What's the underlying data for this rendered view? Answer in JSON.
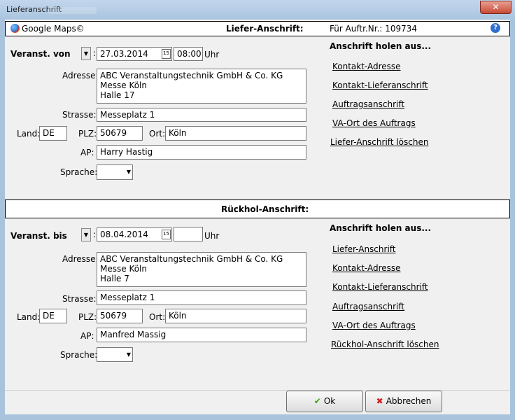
{
  "window": {
    "title": "Lieferanschrift",
    "close_glyph": "✕"
  },
  "top": {
    "maps_label": "Google Maps©",
    "section_title": "Liefer-Anschrift:",
    "order_label": "Für Auftr.Nr.: 109734",
    "help": "?"
  },
  "lief": {
    "date_label": "Veranst. von",
    "colon": ":",
    "date": "27.03.2014",
    "time": "08:00",
    "uhr": "Uhr",
    "address_label": "Adresse:",
    "address": "ABC Veranstaltungstechnik GmbH & Co. KG\nMesse Köln\nHalle 17",
    "street_label": "Strasse:",
    "street": "Messeplatz 1",
    "land_label": "Land:",
    "land": "DE",
    "plz_label": "PLZ:",
    "plz": "50679",
    "ort_label": "Ort:",
    "ort": "Köln",
    "ap_label": "AP:",
    "ap": "Harry Hastig",
    "sprache_label": "Sprache:",
    "sprache": "",
    "side_title": "Anschrift holen aus...",
    "links": [
      "Kontakt-Adresse",
      "Kontakt-Lieferanschrift",
      "Auftragsanschrift",
      "VA-Ort des Auftrags",
      "Liefer-Anschrift löschen"
    ]
  },
  "rueck": {
    "section_title": "Rückhol-Anschrift:",
    "date_label": "Veranst. bis",
    "colon": ":",
    "date": "08.04.2014",
    "time": "",
    "uhr": "Uhr",
    "address_label": "Adresse:",
    "address": "ABC Veranstaltungstechnik GmbH & Co. KG\nMesse Köln\nHalle 7",
    "street_label": "Strasse:",
    "street": "Messeplatz 1",
    "land_label": "Land:",
    "land": "DE",
    "plz_label": "PLZ:",
    "plz": "50679",
    "ort_label": "Ort:",
    "ort": "Köln",
    "ap_label": "AP:",
    "ap": "Manfred Massig",
    "sprache_label": "Sprache:",
    "sprache": "",
    "side_title": "Anschrift holen aus...",
    "links": [
      "Liefer-Anschrift",
      "Kontakt-Adresse",
      "Kontakt-Lieferanschrift",
      "Auftragsanschrift",
      "VA-Ort des Auftrags",
      "Rückhol-Anschrift löschen"
    ]
  },
  "buttons": {
    "ok": "Ok",
    "cancel": "Abbrechen",
    "ok_icon": "✔",
    "cancel_icon": "✖"
  },
  "icons": {
    "calendar": "15",
    "dropdown": "▼"
  }
}
